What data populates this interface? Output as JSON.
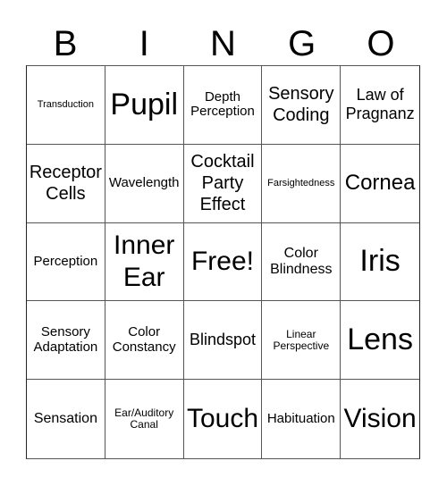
{
  "header": {
    "letters": [
      "B",
      "I",
      "N",
      "G",
      "O"
    ]
  },
  "grid": {
    "rows": [
      [
        "Transduction",
        "Pupil",
        "Depth Perception",
        "Sensory Coding",
        "Law of Pragnanz"
      ],
      [
        "Receptor Cells",
        "Wavelength",
        "Cocktail Party Effect",
        "Farsightedness",
        "Cornea"
      ],
      [
        "Perception",
        "Inner Ear",
        "Free!",
        "Color Blindness",
        "Iris"
      ],
      [
        "Sensory Adaptation",
        "Color Constancy",
        "Blindspot",
        "Linear Perspective",
        "Lens"
      ],
      [
        "Sensation",
        "Ear/Auditory Canal",
        "Touch",
        "Habituation",
        "Vision"
      ]
    ]
  },
  "cells": {
    "r0c0": "Transduction",
    "r0c1": "Pupil",
    "r0c2a": "Depth",
    "r0c2b": "Perception",
    "r0c3a": "Sensory",
    "r0c3b": "Coding",
    "r0c4a": "Law of",
    "r0c4b": "Pragnanz",
    "r1c0a": "Receptor",
    "r1c0b": "Cells",
    "r1c1": "Wavelength",
    "r1c2a": "Cocktail",
    "r1c2b": "Party",
    "r1c2c": "Effect",
    "r1c3": "Farsightedness",
    "r1c4": "Cornea",
    "r2c0": "Perception",
    "r2c1a": "Inner",
    "r2c1b": "Ear",
    "r2c2": "Free!",
    "r2c3a": "Color",
    "r2c3b": "Blindness",
    "r2c4": "Iris",
    "r3c0a": "Sensory",
    "r3c0b": "Adaptation",
    "r3c1a": "Color",
    "r3c1b": "Constancy",
    "r3c2": "Blindspot",
    "r3c3a": "Linear",
    "r3c3b": "Perspective",
    "r3c4": "Lens",
    "r4c0": "Sensation",
    "r4c1a": "Ear/Auditory",
    "r4c1b": "Canal",
    "r4c2": "Touch",
    "r4c3": "Habituation",
    "r4c4": "Vision"
  }
}
